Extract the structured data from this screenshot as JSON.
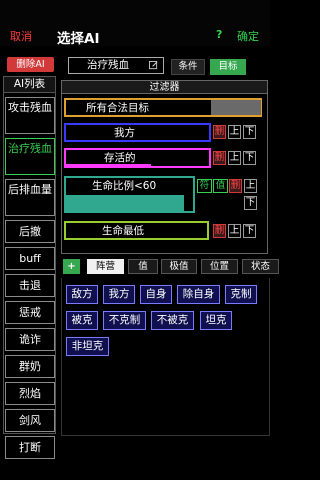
{
  "header": {
    "cancel_label": "取消",
    "title": "选择AI",
    "help_label": "?",
    "confirm_label": "确定"
  },
  "sidebar": {
    "delete_label": "删除AI",
    "list_title": "AI列表",
    "items": [
      {
        "label": "攻击残血",
        "selected": false
      },
      {
        "label": "治疗残血",
        "selected": true
      },
      {
        "label": "后排血量",
        "selected": false
      },
      {
        "label": "后撤",
        "selected": false
      },
      {
        "label": "buff",
        "selected": false
      },
      {
        "label": "击退",
        "selected": false
      },
      {
        "label": "惩戒",
        "selected": false
      },
      {
        "label": "诡诈",
        "selected": false
      },
      {
        "label": "群奶",
        "selected": false
      },
      {
        "label": "烈焰",
        "selected": false
      },
      {
        "label": "剑风",
        "selected": false
      },
      {
        "label": "打断",
        "selected": false
      }
    ]
  },
  "editor": {
    "ai_name": "治疗残血",
    "tab_condition": "条件",
    "tab_target": "目标"
  },
  "filter": {
    "title": "过滤器",
    "rows": [
      {
        "label": "所有合法目标",
        "color": "#e0a030",
        "bar_fill": 0.98
      },
      {
        "label": "我方",
        "color": "#3a3aff",
        "bar_fill": 0.0
      },
      {
        "label": "存活的",
        "color": "#ff3aff",
        "bar_fill": 0.58
      },
      {
        "label": "生命比例<60",
        "color": "#30a890",
        "bar_fill": 0.68
      },
      {
        "label": "生命最低",
        "color": "#9acd32",
        "bar_fill": 0.0
      }
    ],
    "btn_delete": "删",
    "btn_up": "上",
    "btn_down": "下",
    "btn_match": "符",
    "btn_value": "值"
  },
  "tabs": {
    "add_label": "+",
    "items": [
      "阵营",
      "值",
      "极值",
      "位置",
      "状态"
    ]
  },
  "options": [
    "敌方",
    "我方",
    "自身",
    "除自身",
    "克制",
    "被克",
    "不克制",
    "不被克",
    "坦克",
    "非坦克"
  ]
}
